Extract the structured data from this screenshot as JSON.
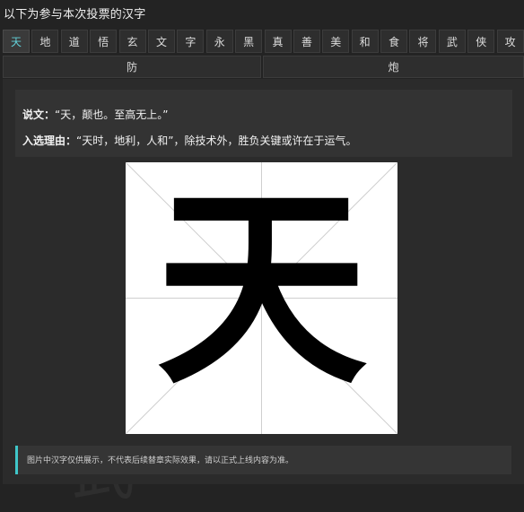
{
  "header": {
    "title": "以下为参与本次投票的汉字"
  },
  "tabs": {
    "row1": [
      "天",
      "地",
      "道",
      "悟",
      "玄",
      "文",
      "字",
      "永",
      "黑",
      "真",
      "善",
      "美",
      "和",
      "食",
      "将",
      "武",
      "侠",
      "攻"
    ],
    "row2": [
      "防",
      "炮"
    ],
    "active": "天"
  },
  "detail": {
    "shuowen_label": "说文：",
    "shuowen_text": "“天，颠也。至高无上。”",
    "reason_label": "入选理由：",
    "reason_text": "“天时，地利，人和”，除技术外，胜负关键或许在于运气。",
    "glyph": "天",
    "notice": "图片中汉字仅供展示，不代表后续替章实际效果，请以正式上线内容为准。"
  },
  "colors": {
    "accent": "#3fc6c9",
    "active_tab_text": "#63d0d8",
    "background": "#232323",
    "panel": "#2b2b2b"
  }
}
